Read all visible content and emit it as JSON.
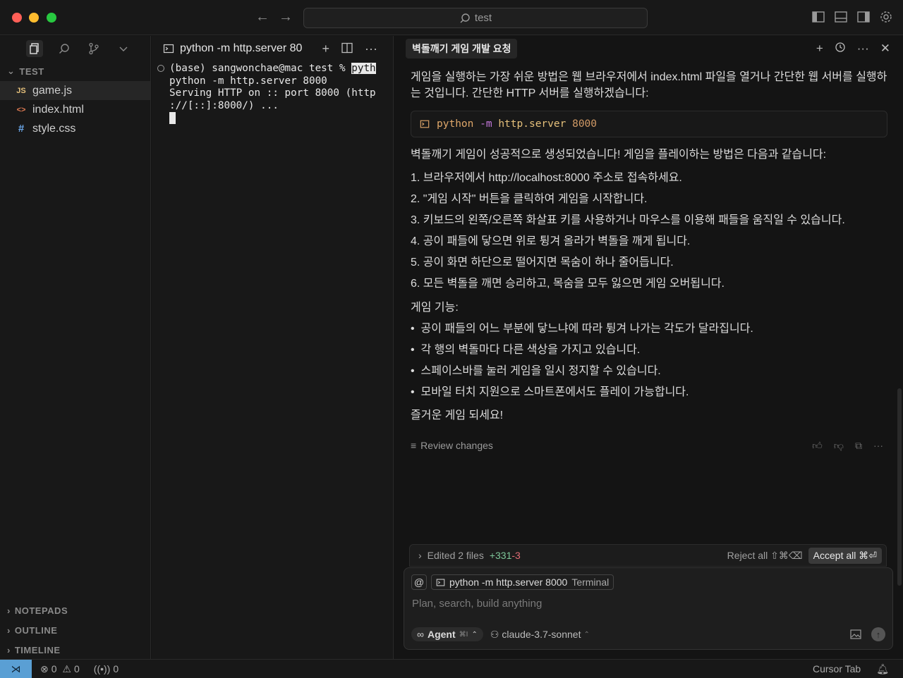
{
  "window": {
    "search_text": "test"
  },
  "explorer": {
    "section": "TEST",
    "files": [
      {
        "name": "game.js",
        "icon": "JS"
      },
      {
        "name": "index.html",
        "icon": "<>"
      },
      {
        "name": "style.css",
        "icon": "#"
      }
    ],
    "bottom_sections": [
      "NOTEPADS",
      "OUTLINE",
      "TIMELINE"
    ]
  },
  "terminal": {
    "tab_title": "python -m http.server 80",
    "lines": {
      "prompt": "(base) sangwonchae@mac test % ",
      "prompt_hl": "pyth",
      "l2": "python -m http.server 8000",
      "l3": "Serving HTTP on :: port 8000 (http",
      "l4": "://[::]:8000/) ..."
    }
  },
  "chat": {
    "title": "벽돌깨기 게임 개발 요청",
    "intro": "게임을 실행하는 가장 쉬운 방법은 웹 브라우저에서 index.html 파일을 열거나 간단한 웹 서버를 실행하는 것입니다. 간단한 HTTP 서버를 실행하겠습니다:",
    "code": {
      "cmd": "python",
      "flag": "-m",
      "module": "http.server",
      "port": "8000"
    },
    "success": "벽돌깨기 게임이 성공적으로 생성되었습니다! 게임을 플레이하는 방법은 다음과 같습니다:",
    "steps": [
      "1. 브라우저에서 http://localhost:8000 주소로 접속하세요.",
      "2. \"게임 시작\" 버튼을 클릭하여 게임을 시작합니다.",
      "3. 키보드의 왼쪽/오른쪽 화살표 키를 사용하거나 마우스를 이용해 패들을 움직일 수 있습니다.",
      "4. 공이 패들에 닿으면 위로 튕겨 올라가 벽돌을 깨게 됩니다.",
      "5. 공이 화면 하단으로 떨어지면 목숨이 하나 줄어듭니다.",
      "6. 모든 벽돌을 깨면 승리하고, 목숨을 모두 잃으면 게임 오버됩니다."
    ],
    "features_title": "게임 기능:",
    "features": [
      "공이 패들의 어느 부분에 닿느냐에 따라 튕겨 나가는 각도가 달라집니다.",
      "각 행의 벽돌마다 다른 색상을 가지고 있습니다.",
      "스페이스바를 눌러 게임을 일시 정지할 수 있습니다.",
      "모바일 터치 지원으로 스마트폰에서도 플레이 가능합니다."
    ],
    "closing": "즐거운 게임 되세요!",
    "review_label": "Review changes",
    "edited": {
      "label": "Edited 2 files",
      "added": "+331",
      "removed": "-3",
      "reject": "Reject all ⇧⌘⌫",
      "accept": "Accept all ⌘⏎"
    },
    "composer": {
      "at": "@",
      "context_chip": "python -m http.server 8000",
      "context_kind": "Terminal",
      "placeholder": "Plan, search, build anything",
      "agent": "Agent",
      "agent_kbd": "⌘I",
      "model": "claude-3.7-sonnet"
    }
  },
  "status": {
    "errors": "0",
    "warnings": "0",
    "ports": "0",
    "cursor_tab": "Cursor Tab"
  }
}
